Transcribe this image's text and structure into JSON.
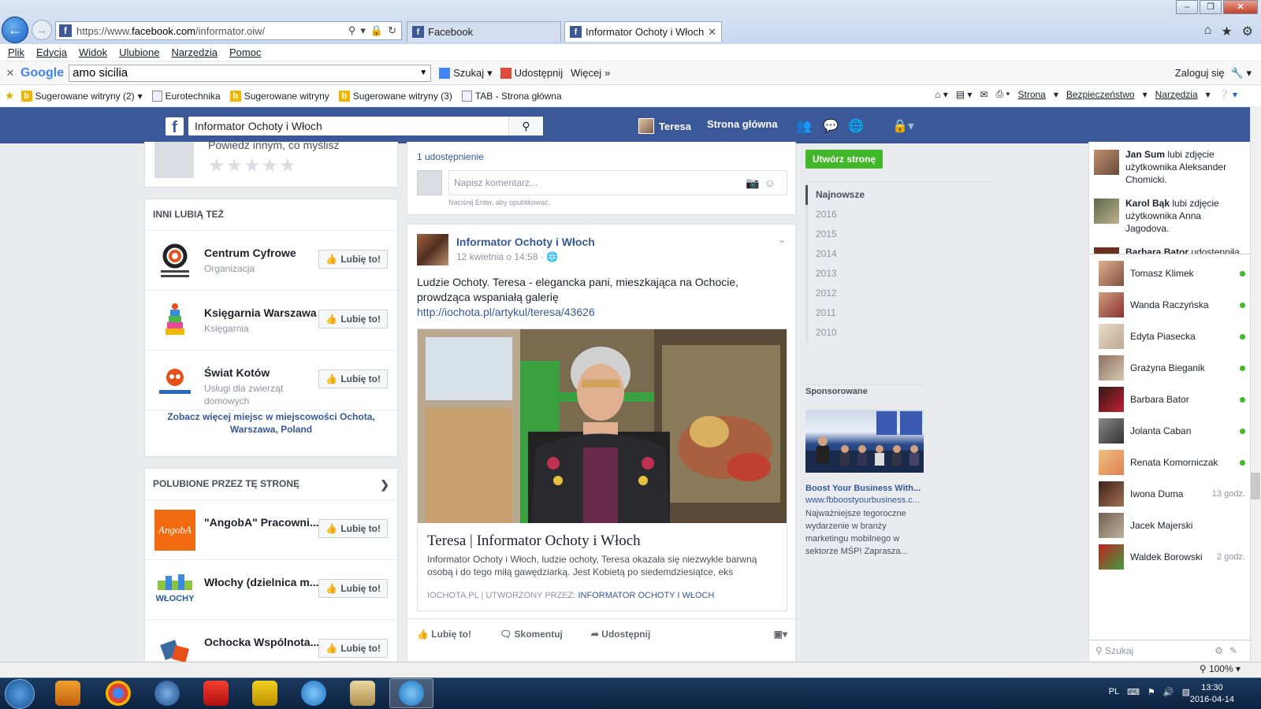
{
  "browser": {
    "url_prefix": "https://www.",
    "url_domain": "facebook.com",
    "url_path": "/informator.oiw/",
    "tabs": [
      {
        "label": "Facebook"
      },
      {
        "label": "Informator Ochoty i Włoch"
      }
    ],
    "menu": [
      "Plik",
      "Edycja",
      "Widok",
      "Ulubione",
      "Narzędzia",
      "Pomoc"
    ],
    "google_bar": {
      "logo": "Google",
      "query": "amo sicilia",
      "search": "Szukaj",
      "share": "Udostępnij",
      "more": "Więcej",
      "login": "Zaloguj się"
    },
    "favorites": [
      "Sugerowane witryny (2)",
      "Eurotechnika",
      "Sugerowane witryny",
      "Sugerowane witryny (3)",
      "TAB - Strona główna"
    ],
    "commands": [
      "Strona",
      "Bezpieczeństwo",
      "Narzędzia"
    ],
    "zoom": "100%"
  },
  "fb_header": {
    "search_value": "Informator Ochoty i Włoch",
    "user": "Teresa",
    "home": "Strona główna"
  },
  "rating": {
    "prompt": "Powiedz innym, co myślisz",
    "stars": "★★★★★"
  },
  "others_like": {
    "header": "INNI LUBIĄ TEŻ",
    "pages": [
      {
        "name": "Centrum Cyfrowe",
        "category": "Organizacja"
      },
      {
        "name": "Księgarnia Warszawa",
        "category": "Księgarnia"
      },
      {
        "name": "Świat Kotów",
        "category": "Usługi dla zwierząt domowych"
      }
    ],
    "like_label": "Lubię to!",
    "see_more": "Zobacz więcej miejsc w miejscowości Ochota, Warszawa, Poland"
  },
  "liked_by_page": {
    "header": "POLUBIONE PRZEZ TĘ STRONĘ",
    "pages": [
      {
        "name": "\"AngobA\" Pracowni..."
      },
      {
        "name": "Włochy (dzielnica m...."
      },
      {
        "name": "Ochocka Wspólnota..."
      }
    ]
  },
  "top_post": {
    "shares": "1 udostępnienie",
    "comment_placeholder": "Napisz komentarz...",
    "hint": "Naciśnij Enter, aby opublikować."
  },
  "post": {
    "author": "Informator Ochoty i Włoch",
    "time": "12 kwietnia o 14:58 · ",
    "text": "Ludzie Ochoty. Teresa - elegancka pani, mieszkająca na Ochocie, prowdząca wspaniałą galerię",
    "link": "http://iochota.pl/artykul/teresa/43626",
    "card_title": "Teresa | Informator Ochoty i Włoch",
    "card_desc": "Informator Ochoty i Włoch, ludzie ochoty, Teresa okazała się niezwykle barwną osobą i do tego miłą gawędziarką. Jest Kobietą po siedemdziesiątce, eks",
    "card_source": "IOCHOTA.PL  |  UTWORZONY PRZEZ: ",
    "card_author": "INFORMATOR OCHOTY I WŁOCH",
    "actions": {
      "like": "Lubię to!",
      "comment": "Skomentuj",
      "share": "Udostępnij"
    }
  },
  "filters": {
    "create_page": "Utwórz stronę",
    "years": [
      "Najnowsze",
      "2016",
      "2015",
      "2014",
      "2013",
      "2012",
      "2011",
      "2010"
    ]
  },
  "sponsored": {
    "header": "Sponsorowane",
    "title": "Boost Your Business With...",
    "url": "www.fbboostyourbusiness.c...",
    "desc": "Najważniejsze tegoroczne wydarzenie w branży marketingu mobilnego w sektorze MŚP! Zaprasza..."
  },
  "ticker": [
    {
      "name": "Jan Sum",
      "text": " lubi zdjęcie użytkownika Aleksander Chomicki."
    },
    {
      "name": "Karol Bąk",
      "text": " lubi zdjęcie użytkownika Anna Jagodova."
    },
    {
      "name": "Barbara Bator",
      "text": " udostępniła"
    }
  ],
  "chat": [
    {
      "name": "Tomasz Klimek",
      "status": ""
    },
    {
      "name": "Wanda Raczyńska",
      "status": ""
    },
    {
      "name": "Edyta Piasecka",
      "status": ""
    },
    {
      "name": "Grażyna Bieganik",
      "status": ""
    },
    {
      "name": "Barbara Bator",
      "status": ""
    },
    {
      "name": "Jolanta Caban",
      "status": ""
    },
    {
      "name": "Renata Komorniczak",
      "status": ""
    },
    {
      "name": "Iwona Duma",
      "status": "13 godz."
    },
    {
      "name": "Jacek Majerski",
      "status": ""
    },
    {
      "name": "Waldek Borowski",
      "status": "2 godz."
    }
  ],
  "chat_search": "Szukaj",
  "taskbar": {
    "lang": "PL",
    "time": "13:30",
    "date": "2016-04-14"
  }
}
